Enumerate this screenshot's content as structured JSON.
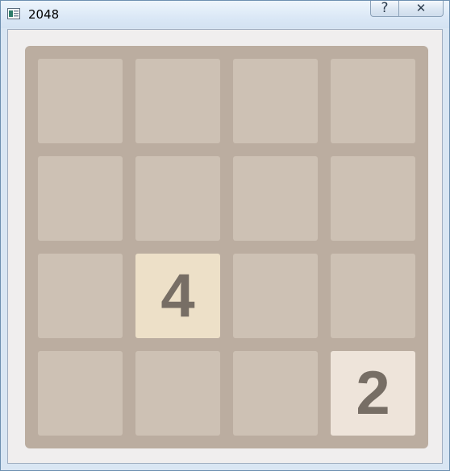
{
  "window": {
    "title": "2048",
    "help_symbol": "?",
    "close_symbol": "✕"
  },
  "board": {
    "size": 4,
    "empty_color": "#cdc1b4",
    "board_color": "#bbada0",
    "tile_text_color": "#776e65",
    "tile_colors": {
      "2": "#eee4da",
      "4": "#ede0c8"
    },
    "cells": [
      [
        null,
        null,
        null,
        null
      ],
      [
        null,
        null,
        null,
        null
      ],
      [
        null,
        "4",
        null,
        null
      ],
      [
        null,
        null,
        null,
        "2"
      ]
    ]
  }
}
